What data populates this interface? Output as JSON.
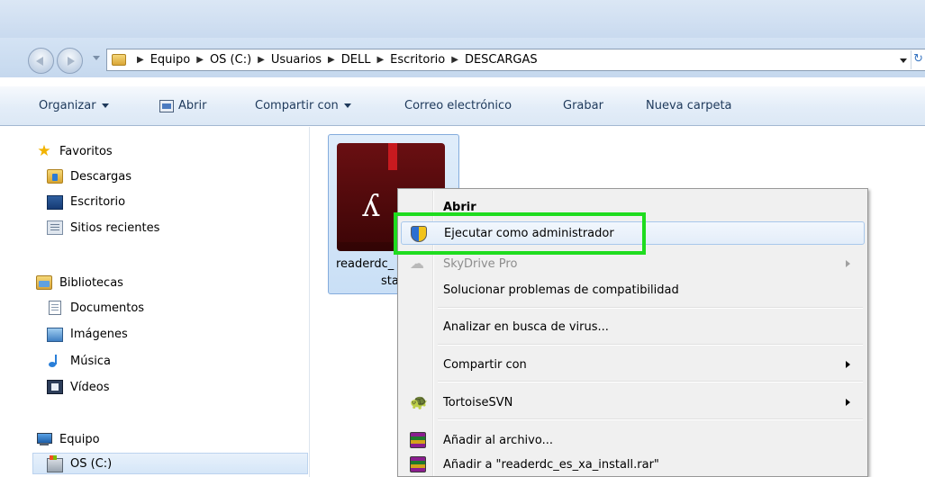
{
  "address": {
    "breadcrumbs": [
      "Equipo",
      "OS (C:)",
      "Usuarios",
      "DELL",
      "Escritorio",
      "DESCARGAS"
    ]
  },
  "toolbar": {
    "organize": "Organizar",
    "open": "Abrir",
    "share": "Compartir con",
    "email": "Correo electrónico",
    "burn": "Grabar",
    "new_folder": "Nueva carpeta"
  },
  "sidebar": {
    "favorites": {
      "label": "Favoritos",
      "items": [
        "Descargas",
        "Escritorio",
        "Sitios recientes"
      ]
    },
    "libraries": {
      "label": "Bibliotecas",
      "items": [
        "Documentos",
        "Imágenes",
        "Música",
        "Vídeos"
      ]
    },
    "computer": {
      "label": "Equipo",
      "items": [
        "OS (C:)"
      ]
    }
  },
  "file": {
    "name_line1": "readerdc_",
    "name_line2": "sta"
  },
  "context_menu": {
    "items": [
      {
        "label": "Abrir",
        "bold": true
      },
      {
        "label": "Ejecutar como administrador",
        "icon": "uac-shield-icon"
      },
      {
        "label": "SkyDrive Pro",
        "disabled": true,
        "submenu": true,
        "icon": "skydrive-icon"
      },
      {
        "label": "Solucionar problemas de compatibilidad"
      },
      {
        "label": "Analizar en busca de virus..."
      },
      {
        "label": "Compartir con",
        "submenu": true
      },
      {
        "label": "TortoiseSVN",
        "submenu": true,
        "icon": "tortoisesvn-icon"
      },
      {
        "label": "Añadir al archivo...",
        "icon": "winrar-icon"
      },
      {
        "label": "Añadir a \"readerdc_es_xa_install.rar\"",
        "icon": "winrar-icon"
      }
    ]
  },
  "colors": {
    "highlight": "#1fdc1f",
    "hover_border": "#a8c8ec",
    "selection": "#c9dff6"
  }
}
